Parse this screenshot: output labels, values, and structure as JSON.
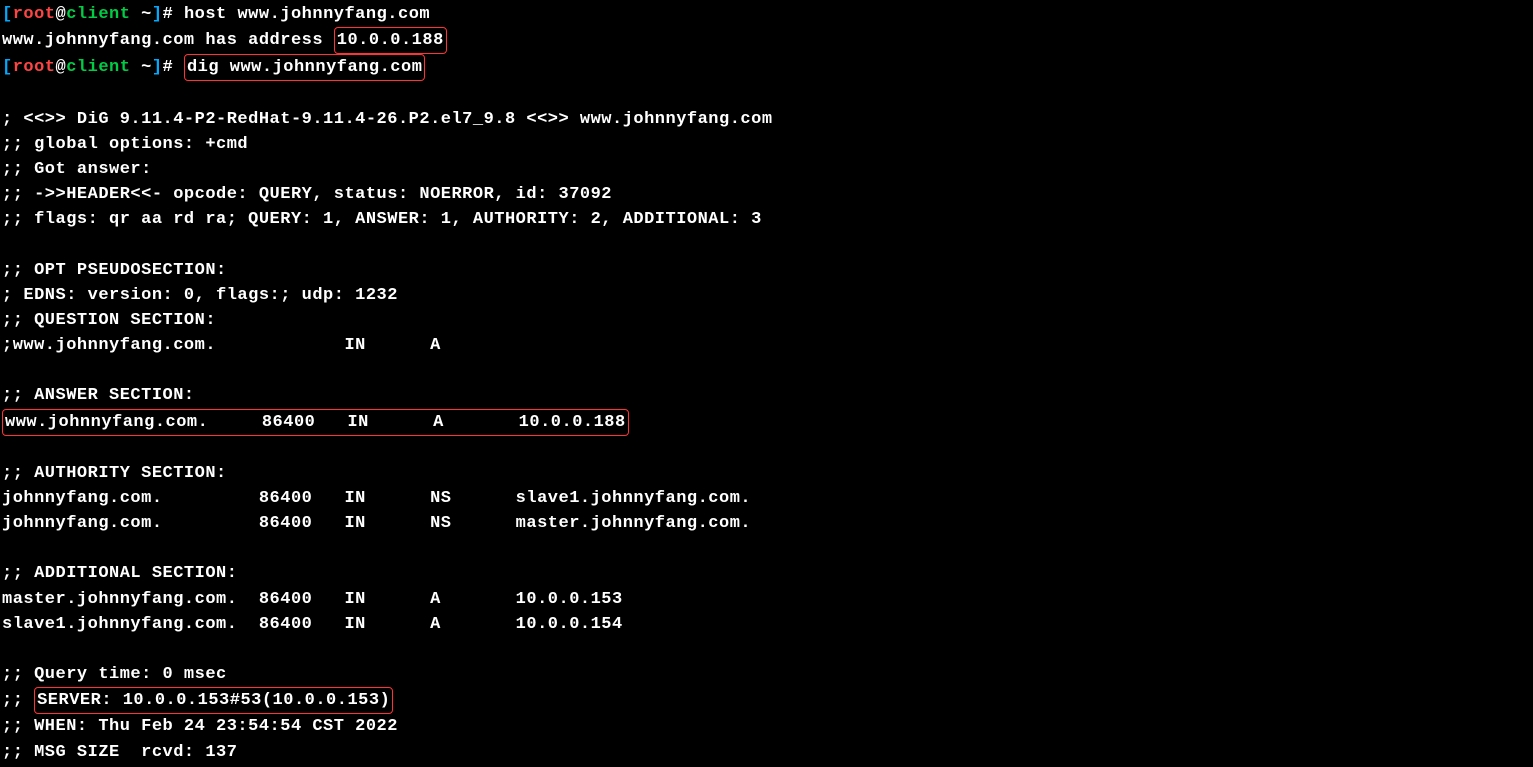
{
  "prompt": {
    "open": "[",
    "user": "root",
    "at": "@",
    "host": "client",
    "path": " ~",
    "close": "]",
    "hash": "# "
  },
  "line1": {
    "cmd": "host www.johnnyfang.com"
  },
  "line2": {
    "pre": "www.johnnyfang.com has address ",
    "ip": "10.0.0.188"
  },
  "line3": {
    "cmd": "dig www.johnnyfang.com"
  },
  "dig": {
    "header": "; <<>> DiG 9.11.4-P2-RedHat-9.11.4-26.P2.el7_9.8 <<>> www.johnnyfang.com",
    "globalopt": ";; global options: +cmd",
    "gotanswer": ";; Got answer:",
    "headerline": ";; ->>HEADER<<- opcode: QUERY, status: NOERROR, id: 37092",
    "flags": ";; flags: qr aa rd ra; QUERY: 1, ANSWER: 1, AUTHORITY: 2, ADDITIONAL: 3",
    "optpseudo": ";; OPT PSEUDOSECTION:",
    "edns": "; EDNS: version: 0, flags:; udp: 1232",
    "questionhdr": ";; QUESTION SECTION:",
    "question": ";www.johnnyfang.com.            IN      A",
    "answerhdr": ";; ANSWER SECTION:",
    "answer": "www.johnnyfang.com.     86400   IN      A       10.0.0.188",
    "authorityhdr": ";; AUTHORITY SECTION:",
    "authority1": "johnnyfang.com.         86400   IN      NS      slave1.johnnyfang.com.",
    "authority2": "johnnyfang.com.         86400   IN      NS      master.johnnyfang.com.",
    "additionalhdr": ";; ADDITIONAL SECTION:",
    "additional1": "master.johnnyfang.com.  86400   IN      A       10.0.0.153",
    "additional2": "slave1.johnnyfang.com.  86400   IN      A       10.0.0.154",
    "querytime": ";; Query time: 0 msec",
    "serverpre": ";; ",
    "server": "SERVER: 10.0.0.153#53(10.0.0.153)",
    "when": ";; WHEN: Thu Feb 24 23:54:54 CST 2022",
    "msgsize": ";; MSG SIZE  rcvd: 137"
  }
}
